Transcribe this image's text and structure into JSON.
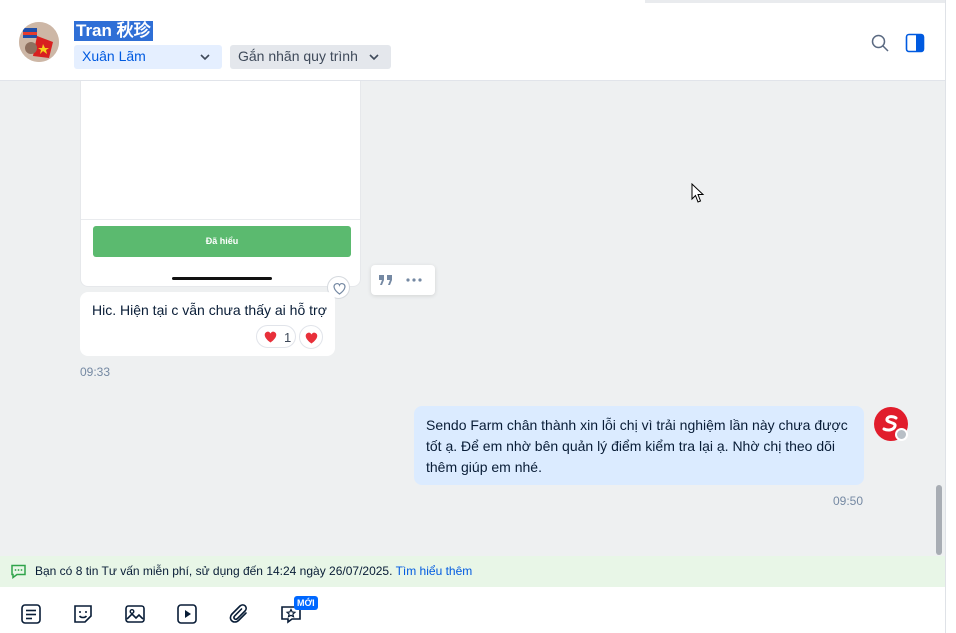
{
  "header": {
    "title": "Tran 秋珍",
    "assignee_dropdown": "Xuân Lãm",
    "tag_dropdown": "Gắn nhãn quy trình"
  },
  "image_message": {
    "button_label": "Đã hiểu"
  },
  "incoming_message": {
    "text": "Hic. Hiện tại c vẫn chưa thấy ai hỗ trợ",
    "reaction_count": "1",
    "time": "09:33"
  },
  "outgoing_message": {
    "text": "Sendo Farm chân thành xin lỗi chị vì trải nghiệm lần này chưa được tốt ạ. Để em nhờ bên quản lý điểm kiểm tra lại ạ. Nhờ chị theo dõi thêm giúp em nhé.",
    "time": "09:50"
  },
  "notice": {
    "text": "Bạn có 8 tin Tư vấn miễn phí, sử dụng đến 14:24 ngày 26/07/2025.",
    "link": "Tìm hiểu thêm"
  },
  "toolbar": {
    "new_badge": "MỚI",
    "icons": [
      "message-template-icon",
      "sticker-icon",
      "image-icon",
      "video-icon",
      "attachment-icon",
      "favorite-message-icon"
    ]
  },
  "colors": {
    "accent": "#005ae0",
    "outgoing_bubble": "#dbebff",
    "notice_bg": "#e8f6e7",
    "confirm_green": "#5bba6f"
  }
}
